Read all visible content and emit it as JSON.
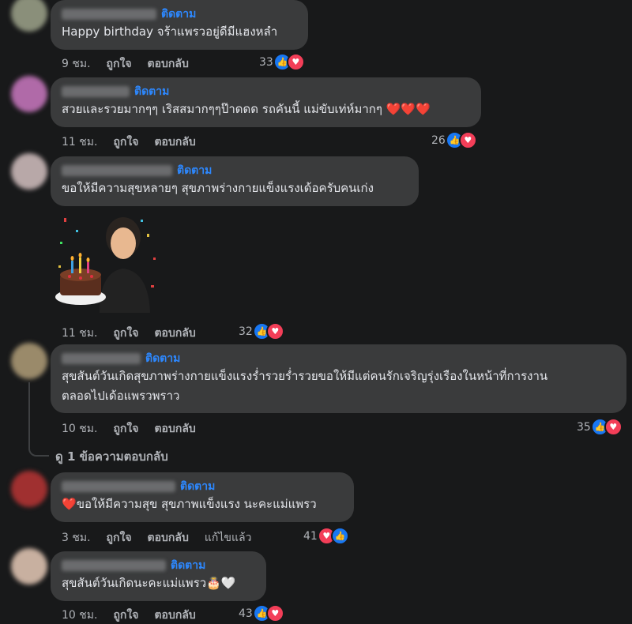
{
  "follow_label": "ติดตาม",
  "comments": [
    {
      "text": "Happy birthday จร้าแพรวอยู่ดีมีแฮงหลำ",
      "time": "9 ชม.",
      "like": "ถูกใจ",
      "reply": "ตอบกลับ",
      "count": "33"
    },
    {
      "text": "สวยและรวยมากๆๆ เริสสมากๆๆป๊าดดด รถคันนี้ แม่ขับเท่ห์มากๆ",
      "hearts": "❤️❤️❤️",
      "time": "11 ชม.",
      "like": "ถูกใจ",
      "reply": "ตอบกลับ",
      "count": "26"
    },
    {
      "text": "ขอให้มีความสุขหลายๆ สุขภาพร่างกายแข็งแรงเด้อครับคนเก่ง",
      "time": "11 ชม.",
      "like": "ถูกใจ",
      "reply": "ตอบกลับ",
      "count": "32"
    },
    {
      "line1": "สุขสันต์วันเกิดสุขภาพร่างกายแข็งแรงร่ำรวยร่ำรวยขอให้มีแต่คนรักเจริญรุ่งเรืองในหน้าที่การงาน",
      "line2": "ตลอดไปเด้อแพรวพราว",
      "time": "10 ชม.",
      "like": "ถูกใจ",
      "reply": "ตอบกลับ",
      "count": "35",
      "view_replies": "ดู 1 ข้อความตอบกลับ"
    },
    {
      "heart": "❤️",
      "text": "ขอให้มีความสุข สุขภาพแข็งแรง นะคะแม่แพรว",
      "time": "3 ชม.",
      "like": "ถูกใจ",
      "reply": "ตอบกลับ",
      "edited": "แก้ไขแล้ว",
      "count": "41"
    },
    {
      "text": "สุขสันต์วันเกิดนะคะแม่แพรว",
      "emoji": "🎂🤍",
      "time": "10 ชม.",
      "like": "ถูกใจ",
      "reply": "ตอบกลับ",
      "count": "43"
    }
  ],
  "colors": {
    "background": "#18191a",
    "bubble": "#3a3b3c",
    "follow": "#2d88ff",
    "like": "#1877f2",
    "love": "#f33e58"
  }
}
